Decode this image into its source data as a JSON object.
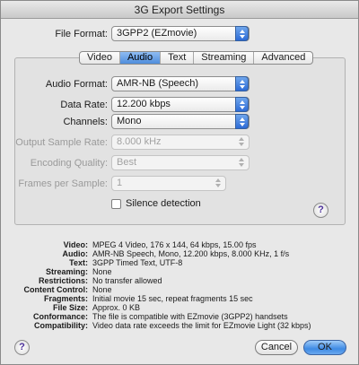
{
  "window": {
    "title": "3G Export Settings"
  },
  "file_format": {
    "label": "File Format:",
    "value": "3GPP2 (EZmovie)"
  },
  "tabs": [
    {
      "label": "Video",
      "active": false
    },
    {
      "label": "Audio",
      "active": true
    },
    {
      "label": "Text",
      "active": false
    },
    {
      "label": "Streaming",
      "active": false
    },
    {
      "label": "Advanced",
      "active": false
    }
  ],
  "audio": {
    "audio_format": {
      "label": "Audio Format:",
      "value": "AMR-NB (Speech)"
    },
    "data_rate": {
      "label": "Data Rate:",
      "value": "12.200 kbps"
    },
    "channels": {
      "label": "Channels:",
      "value": "Mono"
    },
    "output_sample_rate": {
      "label": "Output Sample Rate:",
      "value": "8.000 kHz"
    },
    "encoding_quality": {
      "label": "Encoding Quality:",
      "value": "Best"
    },
    "frames_per_sample": {
      "label": "Frames per Sample:",
      "value": "1"
    },
    "silence_detection": {
      "label": "Silence detection",
      "checked": false
    }
  },
  "summary": [
    {
      "key": "Video:",
      "value": "MPEG 4 Video, 176 x 144, 64 kbps, 15.00 fps"
    },
    {
      "key": "Audio:",
      "value": "AMR-NB Speech, Mono, 12.200 kbps, 8.000 KHz, 1 f/s"
    },
    {
      "key": "Text:",
      "value": "3GPP Timed Text, UTF-8"
    },
    {
      "key": "Streaming:",
      "value": "None"
    },
    {
      "key": "Restrictions:",
      "value": "No transfer allowed"
    },
    {
      "key": "Content Control:",
      "value": "None"
    },
    {
      "key": "Fragments:",
      "value": "Initial movie 15 sec, repeat fragments 15 sec"
    },
    {
      "key": "File Size:",
      "value": "Approx. 0 KB"
    },
    {
      "key": "Conformance:",
      "value": "The file is compatible with EZmovie (3GPP2) handsets"
    },
    {
      "key": "Compatibility:",
      "value": "Video data rate exceeds the limit for EZmovie Light (32 kbps)"
    }
  ],
  "buttons": {
    "help": "?",
    "cancel": "Cancel",
    "ok": "OK"
  },
  "colors": {
    "accent": "#3f8ae4",
    "help_glyph": "#4b2f9a",
    "window_bg": "#e8e8e8"
  }
}
